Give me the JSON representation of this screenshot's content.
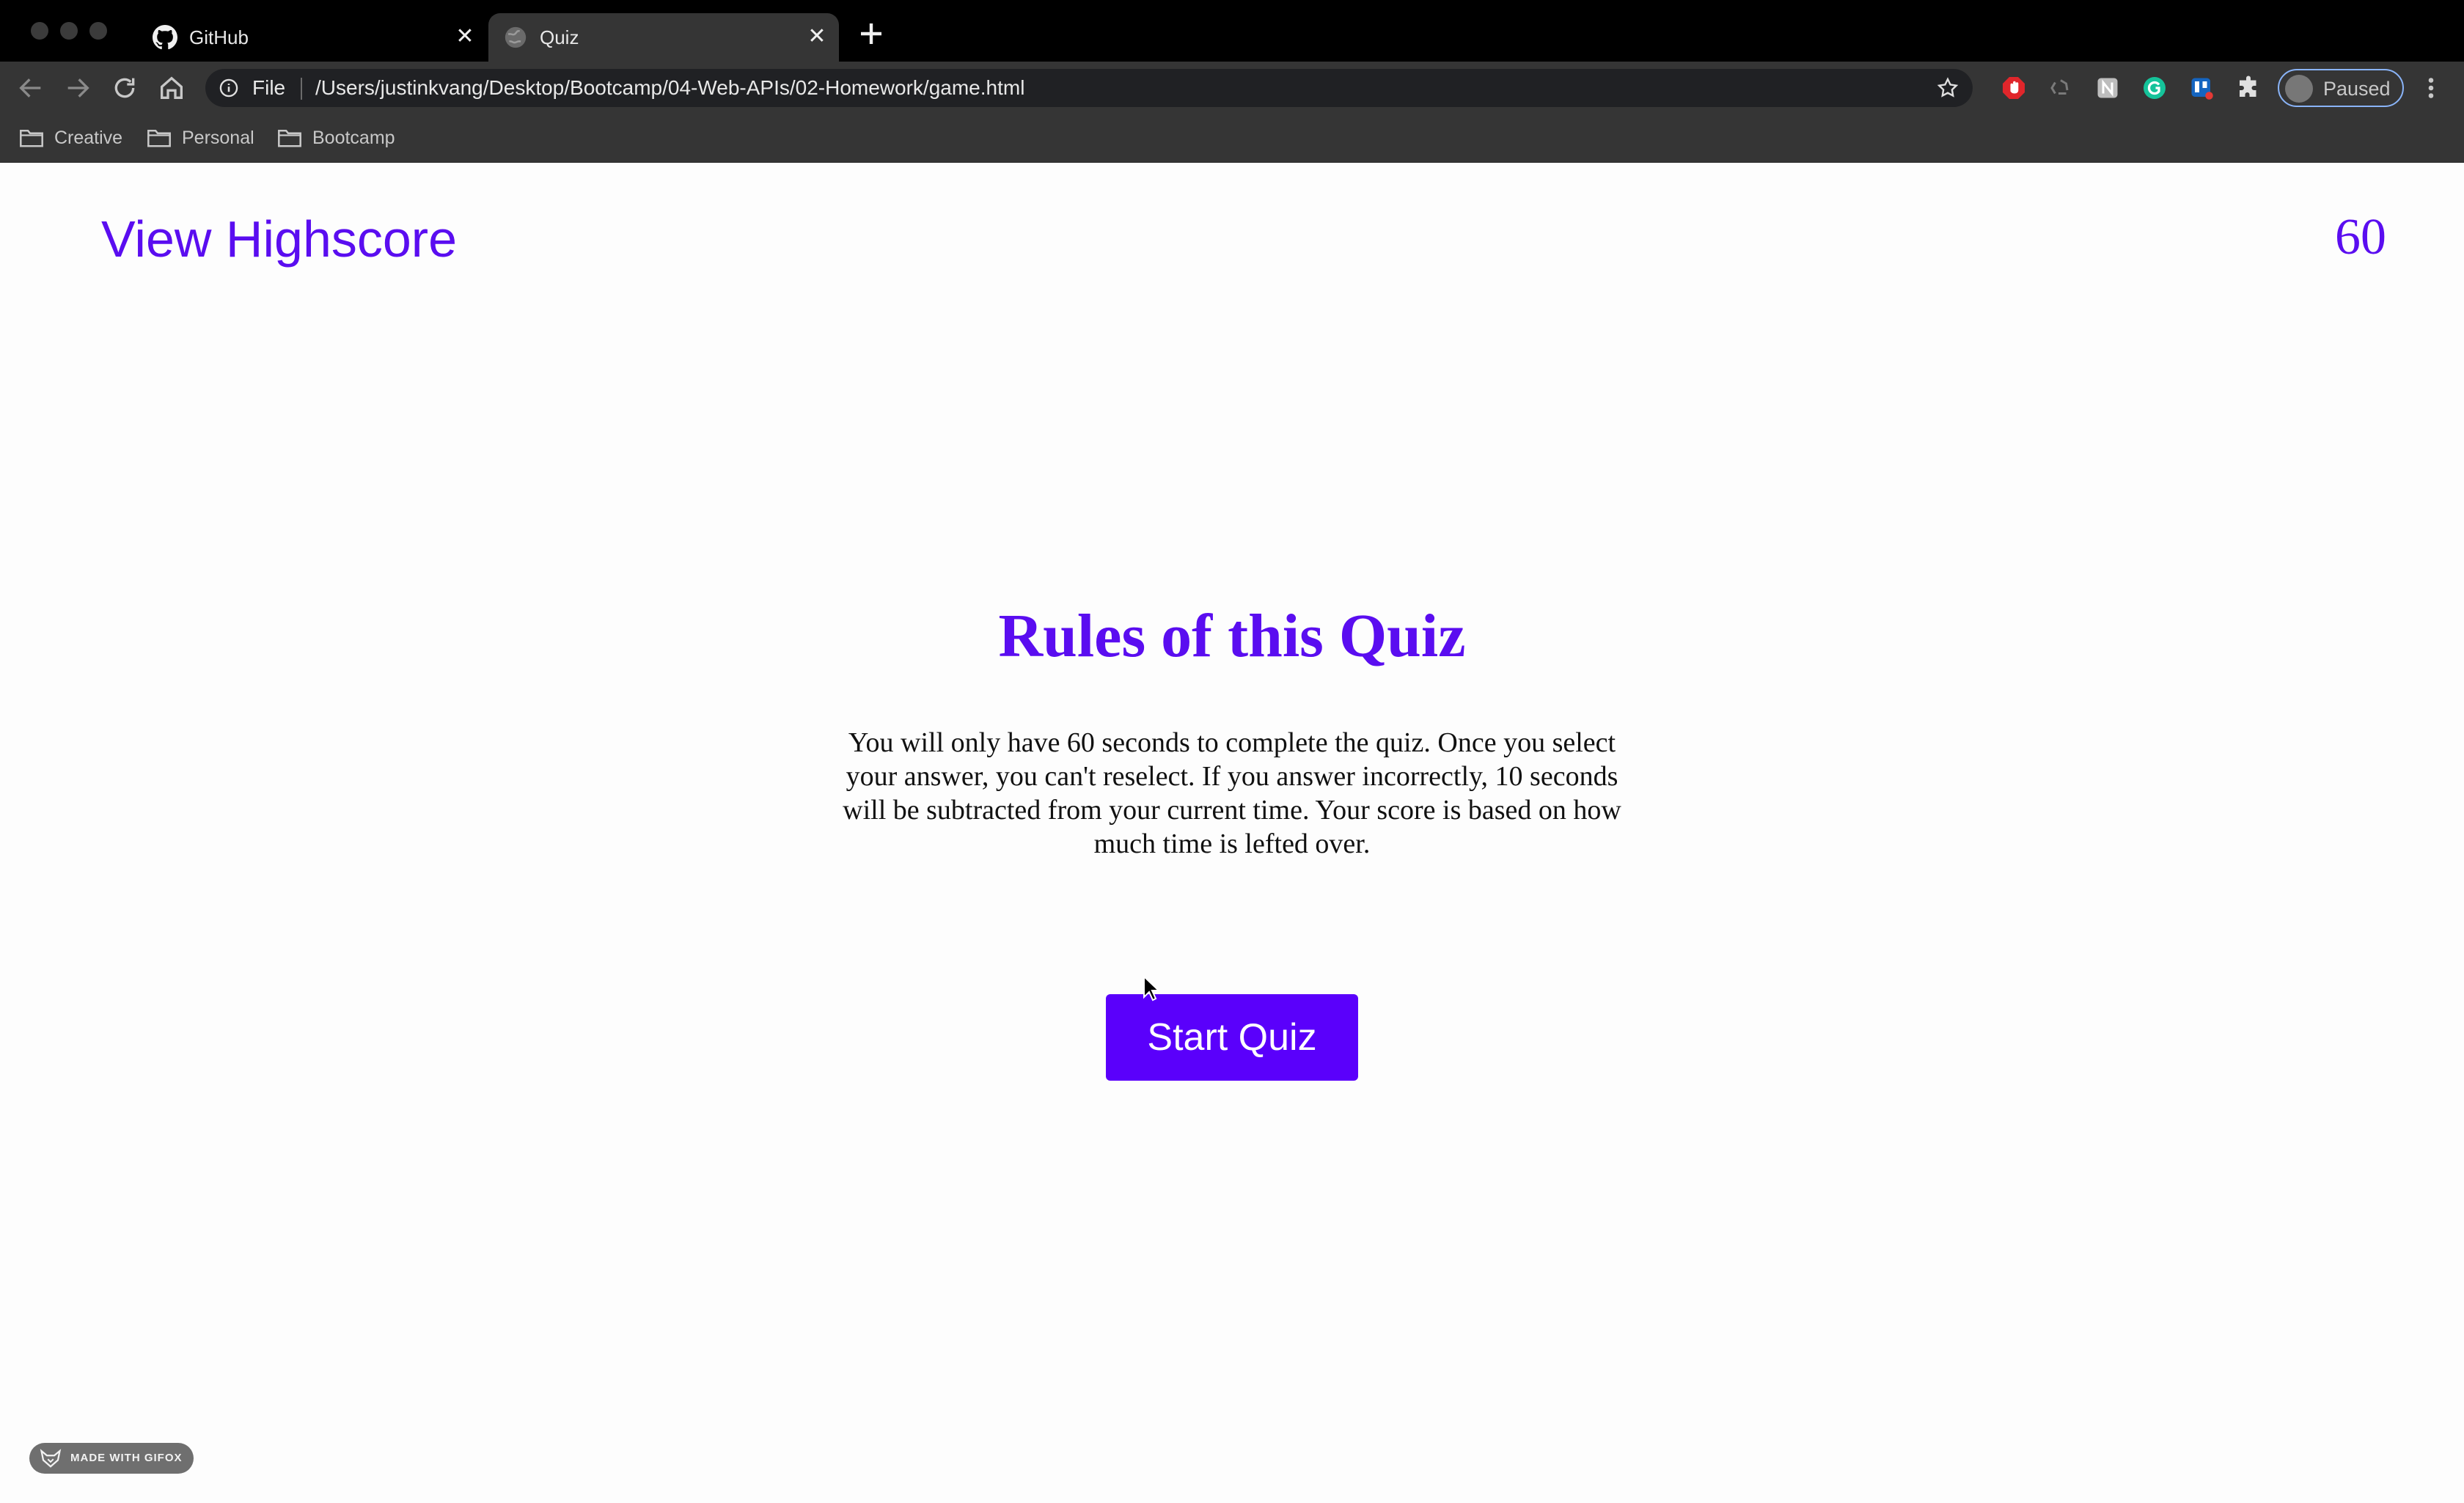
{
  "browser": {
    "tabs": [
      {
        "title": "GitHub",
        "icon": "github-icon",
        "active": false
      },
      {
        "title": "Quiz",
        "icon": "globe-icon",
        "active": true
      }
    ],
    "tab_close_glyph": "✕",
    "address": {
      "scheme_label": "File",
      "url": "/Users/justinkvang/Desktop/Bootcamp/04-Web-APIs/02-Homework/game.html"
    },
    "profile_status": "Paused",
    "bookmarks": [
      {
        "label": "Creative"
      },
      {
        "label": "Personal"
      },
      {
        "label": "Bootcamp"
      }
    ],
    "extensions": [
      "adblock-icon",
      "recycle-icon",
      "notion-icon",
      "grammarly-icon",
      "trello-icon",
      "puzzle-icon"
    ]
  },
  "page": {
    "highscore_link": "View Highscore",
    "timer": "60",
    "title": "Rules of this Quiz",
    "rules": "You will only have 60 seconds to complete the quiz. Once you select your answer, you can't reselect. If you answer incorrectly, 10 seconds will be subtracted from your current time. Your score is based on how much time is lefted over.",
    "start_button": "Start Quiz"
  },
  "watermark": "MADE WITH GIFOX",
  "colors": {
    "accent": "#5a0df0",
    "button": "#5a00fb",
    "chrome_dark": "#000000",
    "chrome_toolbar": "#353535"
  }
}
